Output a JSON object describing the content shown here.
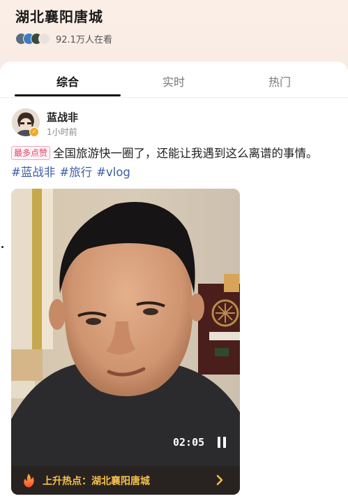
{
  "header": {
    "topic_title": "湖北襄阳唐城",
    "viewers_count": "92.1万人在看",
    "viewer_avatars": [
      "avatar-1",
      "avatar-2",
      "avatar-3",
      "avatar-4"
    ]
  },
  "tabs": [
    {
      "label": "综合",
      "active": true
    },
    {
      "label": "实时",
      "active": false
    },
    {
      "label": "热门",
      "active": false
    }
  ],
  "post": {
    "author": "蓝战非",
    "time": "1小时前",
    "tag_label": "最多点赞",
    "text": "全国旅游快一圈了，还能让我遇到这么离谱的事情。",
    "hashtags": [
      "#蓝战非",
      "#旅行",
      "#vlog"
    ]
  },
  "video": {
    "duration": "02:05",
    "hot_label": "上升热点：湖北襄阳唐城",
    "icons": {
      "pause": "pause-icon",
      "fire": "fire-icon",
      "arrow": "chevron-right-icon"
    }
  },
  "colors": {
    "header_bg": "#f9ece5",
    "tag_pink": "#e0456b",
    "hashtag_blue": "#3b5da8",
    "hot_yellow": "#f3c04a"
  }
}
